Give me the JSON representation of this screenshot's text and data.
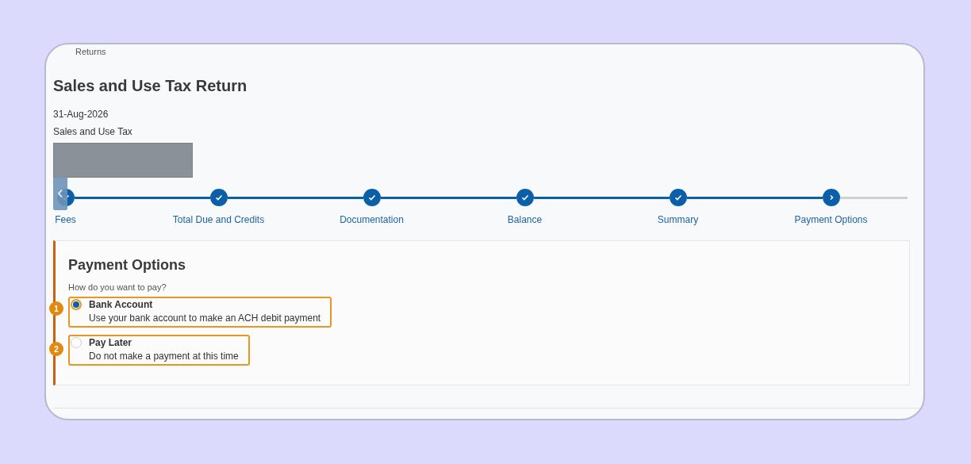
{
  "breadcrumb": "Returns",
  "title": "Sales and Use Tax Return",
  "details": [
    "31-Aug-2026",
    "Sales and Use Tax"
  ],
  "redacted": true,
  "steps": [
    {
      "label": "Fees",
      "kind": "done"
    },
    {
      "label": "Total Due and Credits",
      "kind": "done"
    },
    {
      "label": "Documentation",
      "kind": "done"
    },
    {
      "label": "Balance",
      "kind": "done"
    },
    {
      "label": "Summary",
      "kind": "done"
    },
    {
      "label": "Payment Options",
      "kind": "current"
    }
  ],
  "panel": {
    "heading": "Payment Options",
    "question": "How do you want to pay?",
    "options": [
      {
        "marker": "1",
        "label": "Bank Account",
        "description": "Use your bank account to make an ACH debit payment",
        "selected": true
      },
      {
        "marker": "2",
        "label": "Pay Later",
        "description": "Do not make a payment at this time",
        "selected": false
      }
    ]
  }
}
